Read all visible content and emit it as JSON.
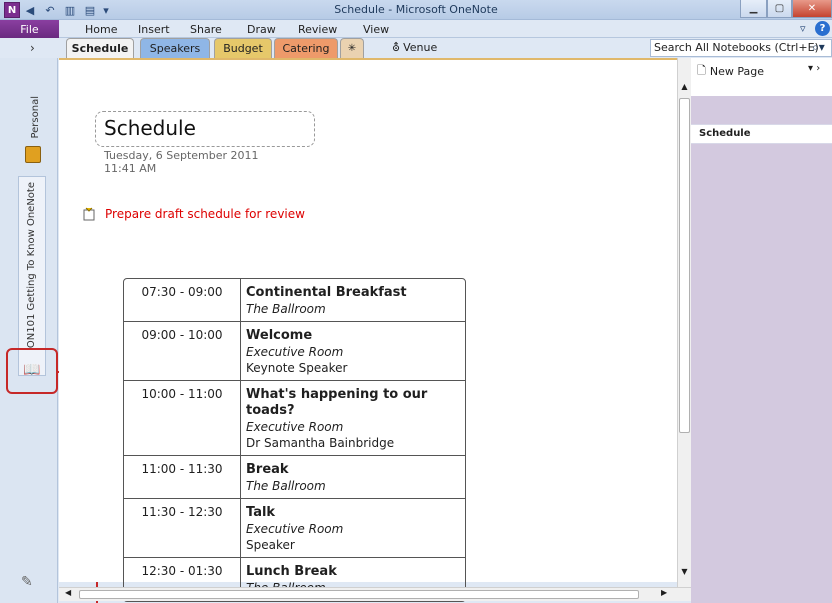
{
  "window": {
    "title": "Schedule - Microsoft OneNote",
    "app_icon": "N"
  },
  "ribbon": {
    "file_label": "File",
    "tabs": [
      "Home",
      "Insert",
      "Share",
      "Draw",
      "Review",
      "View"
    ]
  },
  "sections": {
    "tabs": [
      {
        "label": "Schedule",
        "color": "#f3f3f3"
      },
      {
        "label": "Speakers",
        "color": "#8fb6e6"
      },
      {
        "label": "Budget",
        "color": "#e6c86a"
      },
      {
        "label": "Catering",
        "color": "#ee9a6a"
      },
      {
        "label": "✳",
        "color": "#ead2b0"
      }
    ],
    "venue_label": "Venue"
  },
  "search": {
    "placeholder": "Search All Notebooks (Ctrl+E)"
  },
  "nav": {
    "notebook_1": "Personal",
    "notebook_2": "ON101 Getting To Know OneNote"
  },
  "page": {
    "title": "Schedule",
    "date": "Tuesday, 6 September 2011",
    "time": "11:41 AM",
    "todo": "Prepare draft schedule for review"
  },
  "schedule": [
    {
      "time": "07:30 - 09:00",
      "title": "Continental Breakfast",
      "location": "The Ballroom",
      "speaker": ""
    },
    {
      "time": "09:00 - 10:00",
      "title": "Welcome",
      "location": "Executive Room",
      "speaker": "Keynote Speaker"
    },
    {
      "time": "10:00 - 11:00",
      "title": "What's happening to our toads?",
      "location": "Executive Room",
      "speaker": "Dr Samantha Bainbridge"
    },
    {
      "time": "11:00 - 11:30",
      "title": "Break",
      "location": "The Ballroom",
      "speaker": ""
    },
    {
      "time": "11:30 - 12:30",
      "title": "Talk",
      "location": "Executive Room",
      "speaker": "Speaker"
    },
    {
      "time": "12:30 - 01:30",
      "title": "Lunch Break",
      "location": "The Ballroom",
      "speaker": ""
    }
  ],
  "right_panel": {
    "new_page_label": "New Page",
    "items": [
      "Schedule"
    ]
  },
  "colors": {
    "file_tab": "#7b2d8e",
    "annotation": "#c62828",
    "todo": "#dd0000"
  }
}
